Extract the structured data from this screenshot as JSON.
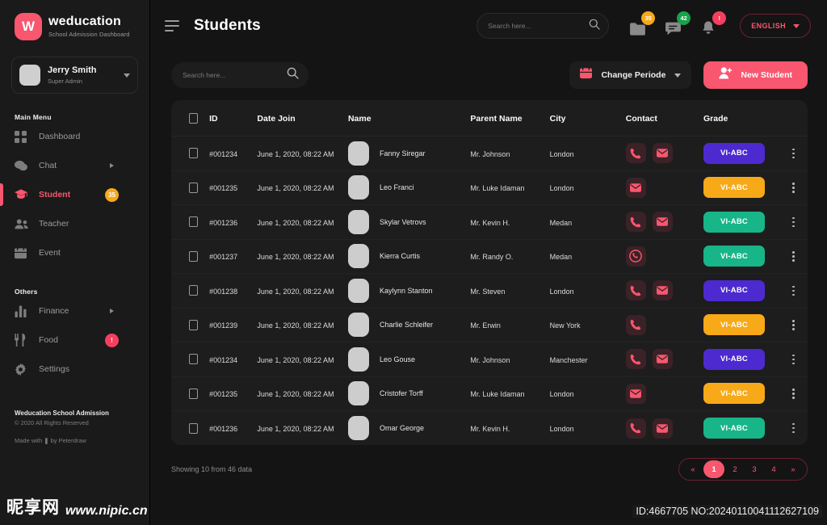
{
  "brand": {
    "logo_letter": "W",
    "name": "weducation",
    "subtitle": "School Admission Dashboard",
    "logo_color": "#f9566f"
  },
  "user": {
    "name": "Jerry Smith",
    "role": "Super Admin",
    "avatar_icon": "user-avatar",
    "caret_icon": "chevron-down-icon"
  },
  "sidebar": {
    "section_main": "Main Menu",
    "section_others": "Others",
    "main_items": [
      {
        "label": "Dashboard",
        "icon": "grid-icon",
        "active": false,
        "arrow": false,
        "badge": null
      },
      {
        "label": "Chat",
        "icon": "chat-icon",
        "active": false,
        "arrow": true,
        "badge": null
      },
      {
        "label": "Student",
        "icon": "graduation-cap-icon",
        "active": true,
        "arrow": false,
        "badge": "35",
        "badge_color": "amber"
      },
      {
        "label": "Teacher",
        "icon": "users-icon",
        "active": false,
        "arrow": false,
        "badge": null
      },
      {
        "label": "Event",
        "icon": "calendar-icon",
        "active": false,
        "arrow": false,
        "badge": null
      }
    ],
    "other_items": [
      {
        "label": "Finance",
        "icon": "bar-chart-icon",
        "active": false,
        "arrow": true,
        "badge": null
      },
      {
        "label": "Food",
        "icon": "fork-knife-icon",
        "active": false,
        "arrow": false,
        "badge": "!",
        "badge_color": "red"
      },
      {
        "label": "Settings",
        "icon": "gear-icon",
        "active": false,
        "arrow": false,
        "badge": null
      }
    ],
    "footer": {
      "title": "Weducation School Admission",
      "copyright": "© 2020 All Rights Reserved",
      "made_with": "Made with ❚ by Peterdraw"
    }
  },
  "header": {
    "menu_icon": "hamburger-icon",
    "title": "Students",
    "search": {
      "placeholder": "Search here...",
      "value": "",
      "icon": "search-icon"
    },
    "icons": [
      {
        "name": "folder-icon",
        "badge": "35",
        "badge_color": "#f7a917"
      },
      {
        "name": "chat-bubble-icon",
        "badge": "42",
        "badge_color": "#16a34a"
      },
      {
        "name": "bell-icon",
        "badge": "!",
        "badge_color": "#f43f5e"
      }
    ],
    "language": {
      "label": "ENGLISH",
      "caret_icon": "chevron-down-icon",
      "color": "#f9566f"
    }
  },
  "toolbar": {
    "search": {
      "placeholder": "Search here...",
      "value": "",
      "icon": "search-icon"
    },
    "periode_button": {
      "label": "Change Periode",
      "icon": "calendar-icon",
      "caret_icon": "chevron-down-icon"
    },
    "new_student_button": {
      "label": "New Student",
      "icon": "user-plus-icon",
      "color": "#f9566f"
    }
  },
  "table": {
    "columns": [
      "",
      "ID",
      "Date Join",
      "Name",
      "Parent Name",
      "City",
      "Contact",
      "Grade",
      ""
    ],
    "rows": [
      {
        "id": "#001234",
        "date": "June 1, 2020, 08:22 AM",
        "name": "Fanny Siregar",
        "parent": "Mr. Johnson",
        "city": "London",
        "contacts": [
          "phone-icon",
          "mail-icon"
        ],
        "grade": "VI-ABC",
        "grade_color": "#4c2ad0"
      },
      {
        "id": "#001235",
        "date": "June 1, 2020, 08:22 AM",
        "name": "Leo Franci",
        "parent": "Mr. Luke Idaman",
        "city": "London",
        "contacts": [
          "mail-icon"
        ],
        "grade": "VI-ABC",
        "grade_color": "#f7a917"
      },
      {
        "id": "#001236",
        "date": "June 1, 2020, 08:22 AM",
        "name": "Skylar Vetrovs",
        "parent": "Mr. Kevin H.",
        "city": "Medan",
        "contacts": [
          "phone-icon",
          "mail-icon"
        ],
        "grade": "VI-ABC",
        "grade_color": "#18b589"
      },
      {
        "id": "#001237",
        "date": "June 1, 2020, 08:22 AM",
        "name": "Kierra Curtis",
        "parent": "Mr. Randy O.",
        "city": "Medan",
        "contacts": [
          "phone-circle-icon"
        ],
        "grade": "VI-ABC",
        "grade_color": "#18b589"
      },
      {
        "id": "#001238",
        "date": "June 1, 2020, 08:22 AM",
        "name": "Kaylynn Stanton",
        "parent": "Mr. Steven",
        "city": "London",
        "contacts": [
          "phone-icon",
          "mail-icon"
        ],
        "grade": "VI-ABC",
        "grade_color": "#4c2ad0"
      },
      {
        "id": "#001239",
        "date": "June 1, 2020, 08:22 AM",
        "name": "Charlie Schleifer",
        "parent": "Mr. Erwin",
        "city": "New York",
        "contacts": [
          "phone-icon"
        ],
        "grade": "VI-ABC",
        "grade_color": "#f7a917"
      },
      {
        "id": "#001234",
        "date": "June 1, 2020, 08:22 AM",
        "name": "Leo Gouse",
        "parent": "Mr. Johnson",
        "city": "Manchester",
        "contacts": [
          "phone-icon",
          "mail-icon"
        ],
        "grade": "VI-ABC",
        "grade_color": "#4c2ad0"
      },
      {
        "id": "#001235",
        "date": "June 1, 2020, 08:22 AM",
        "name": "Cristofer Torff",
        "parent": "Mr. Luke Idaman",
        "city": "London",
        "contacts": [
          "mail-icon"
        ],
        "grade": "VI-ABC",
        "grade_color": "#f7a917"
      },
      {
        "id": "#001236",
        "date": "June 1, 2020, 08:22 AM",
        "name": "Omar George",
        "parent": "Mr. Kevin H.",
        "city": "London",
        "contacts": [
          "phone-icon",
          "mail-icon"
        ],
        "grade": "VI-ABC",
        "grade_color": "#18b589"
      }
    ]
  },
  "footer": {
    "showing": "Showing 10 from 46 data",
    "pagination": {
      "prev": "«",
      "next": "»",
      "pages": [
        "1",
        "2",
        "3",
        "4"
      ],
      "current": "1"
    }
  },
  "watermark": {
    "cn_text": "昵享网",
    "url": "www.nipic.cn",
    "id_text": "ID:4667705 NO:20240110041112627109"
  }
}
